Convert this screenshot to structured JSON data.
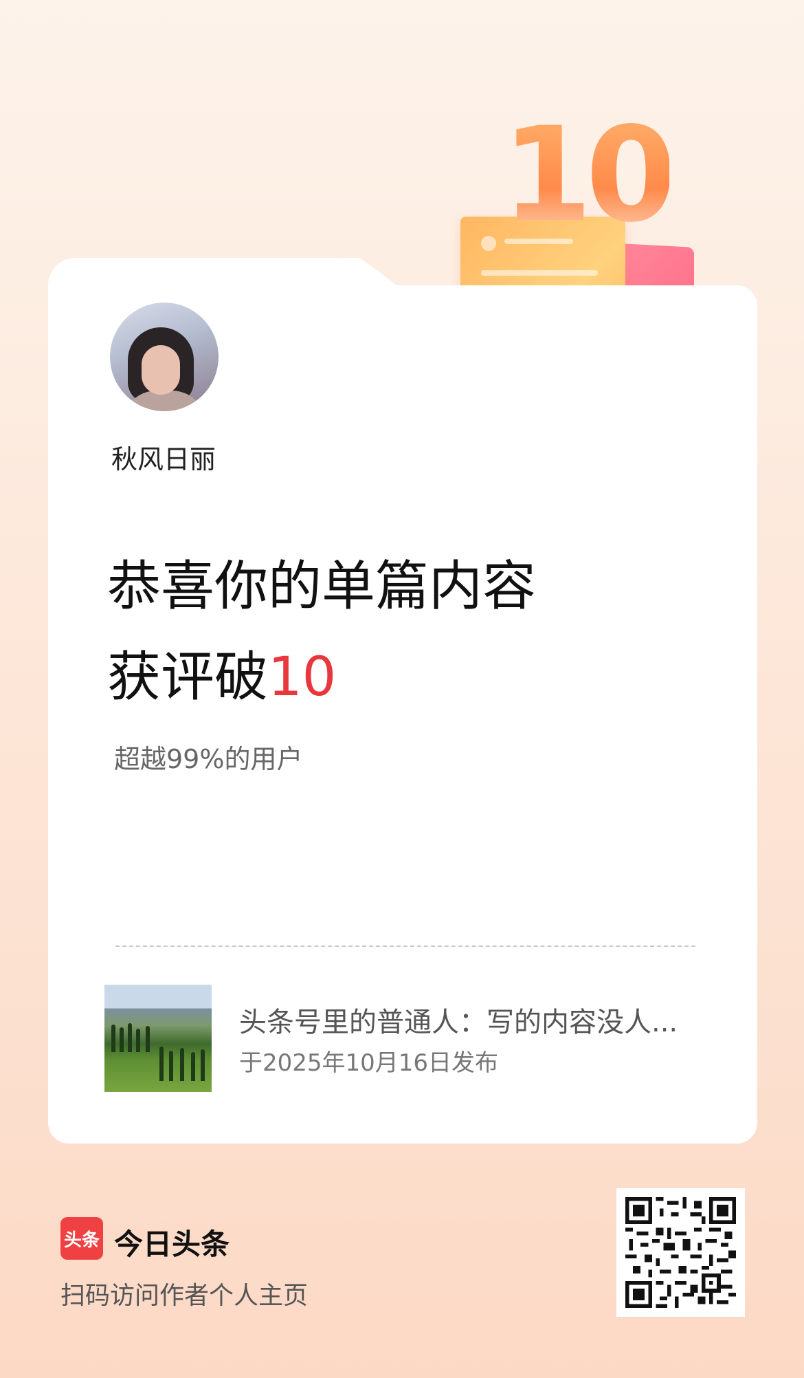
{
  "badge": {
    "number": "10"
  },
  "profile": {
    "username": "秋风日丽"
  },
  "headline": {
    "line1": "恭喜你的单篇内容",
    "line2_prefix": "获评破",
    "line2_number": "10"
  },
  "subtitle": "超越99%的用户",
  "article": {
    "title": "头条号里的普通人：写的内容没人...",
    "date": "于2025年10月16日发布"
  },
  "footer": {
    "logo_text": "头条",
    "app_name": "今日头条",
    "caption": "扫码访问作者个人主页"
  },
  "colors": {
    "accent": "#e8383d",
    "brand": "#f04142"
  }
}
